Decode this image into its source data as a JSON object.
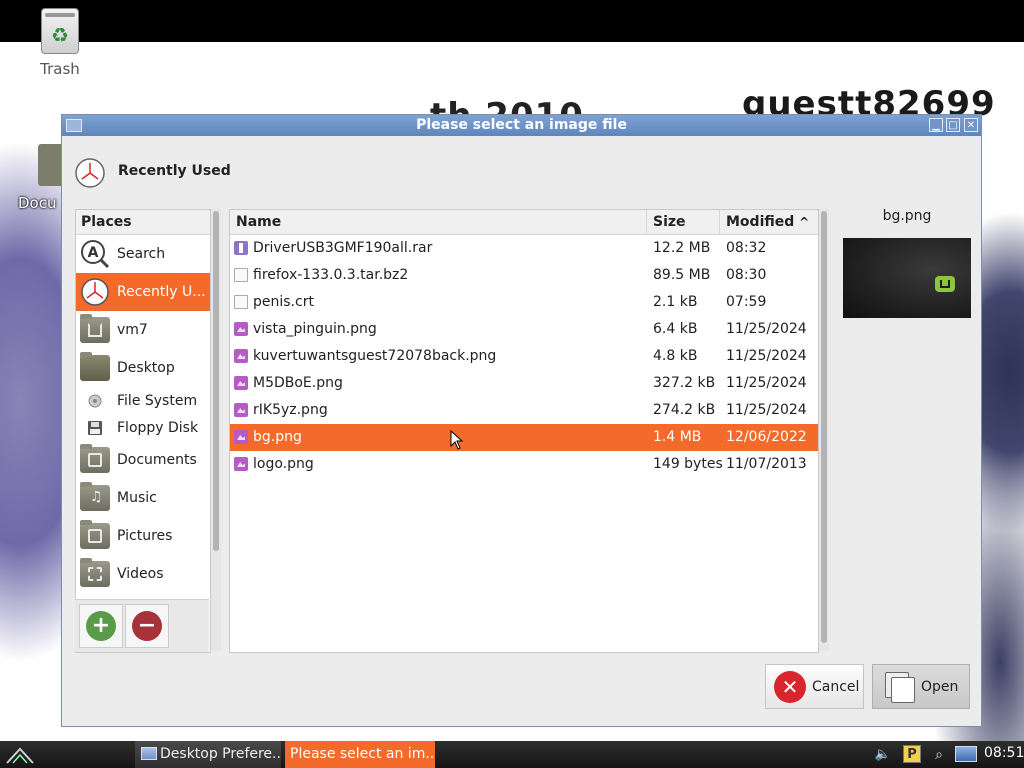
{
  "desktop": {
    "trash_label": "Trash",
    "documents_label_partial": "Docu",
    "wall_text_left": "th    2010",
    "wall_text_right": "guestt82699"
  },
  "dialog": {
    "title": "Please select an image file",
    "location_label": "Recently Used",
    "places_header": "Places",
    "places": [
      {
        "label": "Search",
        "icon": "search-icon"
      },
      {
        "label": "Recently U...",
        "icon": "clock-icon",
        "selected": true
      },
      {
        "label": "vm7",
        "icon": "home-folder-icon"
      },
      {
        "label": "Desktop",
        "icon": "desktop-folder-icon"
      },
      {
        "label": "File System",
        "icon": "hard-disk-icon"
      },
      {
        "label": "Floppy Disk",
        "icon": "floppy-disk-icon"
      },
      {
        "label": "Documents",
        "icon": "documents-folder-icon"
      },
      {
        "label": "Music",
        "icon": "music-folder-icon"
      },
      {
        "label": "Pictures",
        "icon": "pictures-folder-icon"
      },
      {
        "label": "Videos",
        "icon": "videos-folder-icon"
      }
    ],
    "columns": {
      "name": "Name",
      "size": "Size",
      "modified": "Modified",
      "sort_indicator": "^"
    },
    "files": [
      {
        "name": "DriverUSB3GMF190all.rar",
        "size": "12.2 MB",
        "modified": "08:32",
        "icon": "archive-icon"
      },
      {
        "name": "firefox-133.0.3.tar.bz2",
        "size": "89.5 MB",
        "modified": "08:30",
        "icon": "document-icon"
      },
      {
        "name": "penis.crt",
        "size": "2.1 kB",
        "modified": "07:59",
        "icon": "document-icon"
      },
      {
        "name": "vista_pinguin.png",
        "size": "6.4 kB",
        "modified": "11/25/2024",
        "icon": "image-icon"
      },
      {
        "name": "kuvertuwantsguest72078back.png",
        "size": "4.8 kB",
        "modified": "11/25/2024",
        "icon": "image-icon"
      },
      {
        "name": "M5DBoE.png",
        "size": "327.2 kB",
        "modified": "11/25/2024",
        "icon": "image-icon"
      },
      {
        "name": "rIK5yz.png",
        "size": "274.2 kB",
        "modified": "11/25/2024",
        "icon": "image-icon"
      },
      {
        "name": "bg.png",
        "size": "1.4 MB",
        "modified": "12/06/2022",
        "icon": "image-icon",
        "selected": true
      },
      {
        "name": "logo.png",
        "size": "149 bytes",
        "modified": "11/07/2013",
        "icon": "image-icon"
      }
    ],
    "preview_label": "bg.png",
    "cancel_label": "Cancel",
    "open_label": "Open"
  },
  "taskbar": {
    "tasks": [
      {
        "label": "Desktop Prefere..."
      },
      {
        "label": "Please select an im...",
        "active": true
      }
    ],
    "tray_p": "P",
    "clock": "08:51"
  },
  "colors": {
    "accent": "#f36a2a",
    "titlebar": "#6e93c7",
    "cancel_red": "#d9252c"
  }
}
